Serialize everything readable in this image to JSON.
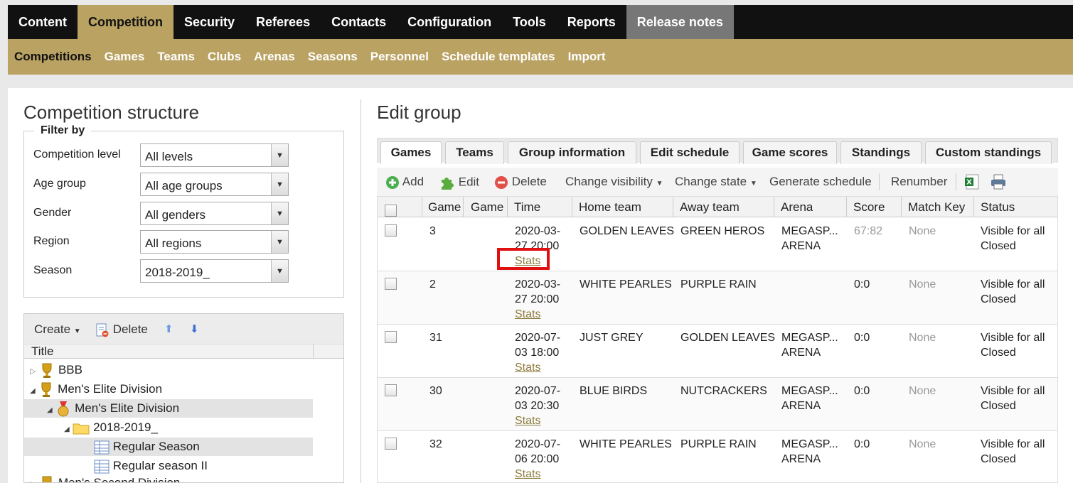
{
  "topnav": [
    "Content",
    "Competition",
    "Security",
    "Referees",
    "Contacts",
    "Configuration",
    "Tools",
    "Reports",
    "Release notes"
  ],
  "subnav": [
    "Competitions",
    "Games",
    "Teams",
    "Clubs",
    "Arenas",
    "Seasons",
    "Personnel",
    "Schedule templates",
    "Import"
  ],
  "left": {
    "title": "Competition structure",
    "filter_legend": "Filter by",
    "filters": [
      {
        "label": "Competition level",
        "value": "All levels"
      },
      {
        "label": "Age group",
        "value": "All age groups"
      },
      {
        "label": "Gender",
        "value": "All genders"
      },
      {
        "label": "Region",
        "value": "All regions"
      },
      {
        "label": "Season",
        "value": "2018-2019_"
      }
    ],
    "tree_toolbar": {
      "create": "Create",
      "delete": "Delete"
    },
    "tree_header": "Title",
    "tree": [
      "BBB",
      "Men's Elite Division",
      "Men's Elite Division",
      "2018-2019_",
      "Regular Season",
      "Regular season II",
      "Men's Second Division"
    ]
  },
  "right": {
    "title": "Edit group",
    "tabs": [
      "Games",
      "Teams",
      "Group information",
      "Edit schedule",
      "Game scores",
      "Standings",
      "Custom standings"
    ],
    "toolbar": {
      "add": "Add",
      "edit": "Edit",
      "delete": "Delete",
      "visibility": "Change visibility",
      "state": "Change state",
      "generate": "Generate schedule",
      "renumber": "Renumber"
    },
    "columns": [
      "Game",
      "Game",
      "Time",
      "Home team",
      "Away team",
      "Arena",
      "Score",
      "Match Key",
      "Status"
    ],
    "rows": [
      {
        "game": "3",
        "time": "2020-03-\n27 20:00",
        "stats": "Stats",
        "home": "GOLDEN LEAVES",
        "away": "GREEN HEROS",
        "arena": "MEGASP...\nARENA",
        "score": "67:82",
        "key": "None",
        "status": "Visible for all\nClosed"
      },
      {
        "game": "2",
        "time": "2020-03-\n27 20:00",
        "stats": "Stats",
        "home": "WHITE PEARLES",
        "away": "PURPLE RAIN",
        "arena": "",
        "score": "0:0",
        "key": "None",
        "status": "Visible for all\nClosed"
      },
      {
        "game": "31",
        "time": "2020-07-\n03 18:00",
        "stats": "Stats",
        "home": "JUST GREY",
        "away": "GOLDEN LEAVES",
        "arena": "MEGASP...\nARENA",
        "score": "0:0",
        "key": "None",
        "status": "Visible for all\nClosed"
      },
      {
        "game": "30",
        "time": "2020-07-\n03 20:30",
        "stats": "Stats",
        "home": "BLUE BIRDS",
        "away": "NUTCRACKERS",
        "arena": "MEGASP...\nARENA",
        "score": "0:0",
        "key": "None",
        "status": "Visible for all\nClosed"
      },
      {
        "game": "32",
        "time": "2020-07-\n06 20:00",
        "stats": "Stats",
        "home": "WHITE PEARLES",
        "away": "PURPLE RAIN",
        "arena": "MEGASP...\nARENA",
        "score": "0:0",
        "key": "None",
        "status": "Visible for all\nClosed"
      }
    ]
  }
}
